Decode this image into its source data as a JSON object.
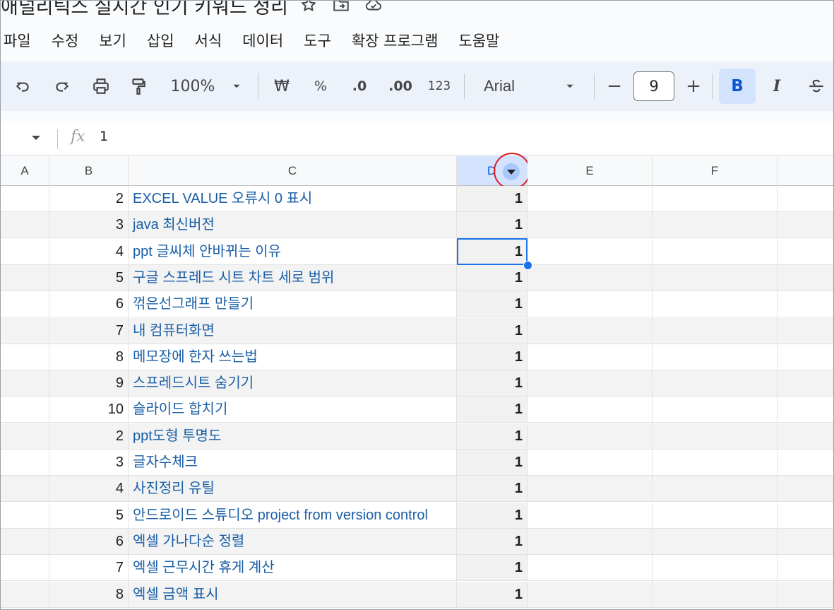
{
  "document": {
    "title": "애널리틱스 실시간 인기 키워드 정리"
  },
  "menu": [
    "파일",
    "수정",
    "보기",
    "삽입",
    "서식",
    "데이터",
    "도구",
    "확장 프로그램",
    "도움말"
  ],
  "toolbar": {
    "zoom": "100%",
    "currency": "₩",
    "percent": "%",
    "decrease_decimal": ".0",
    "increase_decimal": ".00",
    "number_format": "123",
    "font": "Arial",
    "font_size": "9",
    "minus": "−",
    "plus": "+",
    "bold": "B",
    "italic": "I"
  },
  "formula_bar": {
    "fx": "fx",
    "value": "1"
  },
  "columns": [
    "A",
    "B",
    "C",
    "D",
    "E",
    "F"
  ],
  "rows": [
    {
      "b": "2",
      "c": "EXCEL VALUE 오류시 0 표시",
      "d": "1"
    },
    {
      "b": "3",
      "c": "java 최신버전",
      "d": "1"
    },
    {
      "b": "4",
      "c": "ppt 글씨체 안바뀌는 이유",
      "d": "1"
    },
    {
      "b": "5",
      "c": "구글 스프레드 시트 차트 세로 범위",
      "d": "1"
    },
    {
      "b": "6",
      "c": "꺾은선그래프 만들기",
      "d": "1"
    },
    {
      "b": "7",
      "c": "내 컴퓨터화면",
      "d": "1"
    },
    {
      "b": "8",
      "c": "메모장에 한자 쓰는법",
      "d": "1"
    },
    {
      "b": "9",
      "c": "스프레드시트 숨기기",
      "d": "1"
    },
    {
      "b": "10",
      "c": "슬라이드 합치기",
      "d": "1"
    },
    {
      "b": "2",
      "c": "ppt도형 투명도",
      "d": "1"
    },
    {
      "b": "3",
      "c": "글자수체크",
      "d": "1"
    },
    {
      "b": "4",
      "c": "사진정리 유틸",
      "d": "1"
    },
    {
      "b": "5",
      "c": "안드로이드 스튜디오 project from version control",
      "d": "1"
    },
    {
      "b": "6",
      "c": "엑셀 가나다순 정렬",
      "d": "1"
    },
    {
      "b": "7",
      "c": "엑셀 근무시간 휴게 계산",
      "d": "1"
    },
    {
      "b": "8",
      "c": "엑셀 금액 표시",
      "d": "1"
    }
  ],
  "colors": {
    "link_text": "#1a5fa6",
    "selection": "#1a73e8",
    "highlight_circle": "#e11d1d"
  }
}
